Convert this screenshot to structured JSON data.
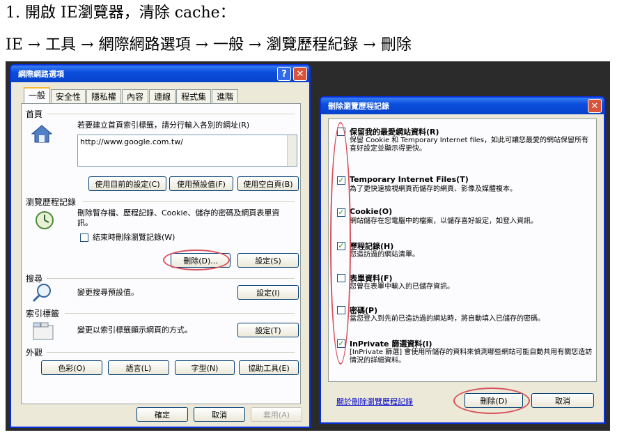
{
  "instructions": {
    "line1": "1. 開啟 IE瀏覽器，清除 cache：",
    "line2": "IE → 工具 → 網際網路選項 → 一般 → 瀏覽歷程紀錄 → 刪除"
  },
  "internet_options": {
    "title": "網際網路選項",
    "tabs": [
      "一般",
      "安全性",
      "隱私權",
      "內容",
      "連線",
      "程式集",
      "進階"
    ],
    "home": {
      "label": "首頁",
      "desc": "若要建立首頁索引標籤，請分行輸入各別的網址(R)",
      "url": "http://www.google.com.tw/",
      "buttons": [
        "使用目前的設定(C)",
        "使用預設值(F)",
        "使用空白頁(B)"
      ]
    },
    "history": {
      "label": "瀏覽歷程記錄",
      "desc": "刪除暫存檔、歷程記錄、Cookie、儲存的密碼及網頁表單資訊。",
      "checkbox": "結束時刪除瀏覽記錄(W)",
      "delete_btn": "刪除(D)...",
      "settings_btn": "設定(S)"
    },
    "search": {
      "label": "搜尋",
      "desc": "變更搜尋預設值。",
      "settings_btn": "設定(I)"
    },
    "tabs_section": {
      "label": "索引標籤",
      "desc": "變更以索引標籤顯示網頁的方式。",
      "settings_btn": "設定(T)"
    },
    "appearance": {
      "label": "外觀",
      "buttons": [
        "色彩(O)",
        "語言(L)",
        "字型(N)",
        "協助工具(E)"
      ]
    },
    "footer": {
      "ok": "確定",
      "cancel": "取消",
      "apply": "套用(A)"
    }
  },
  "delete_history": {
    "title": "刪除瀏覽歷程記錄",
    "items": [
      {
        "title": "保留我的最愛網站資料(R)",
        "desc": "保留 Cookie 和 Temporary Internet files，如此可讓您最愛的網站保留所有喜好設定並顯示得更快。",
        "checked": false
      },
      {
        "title": "Temporary Internet Files(T)",
        "desc": "為了更快速檢視網頁而儲存的網頁、影像及媒體複本。",
        "checked": true
      },
      {
        "title": "Cookie(O)",
        "desc": "網站儲存在您電腦中的檔案，以儲存喜好設定，如登入資訊。",
        "checked": true
      },
      {
        "title": "歷程記錄(H)",
        "desc": "您造訪過的網站清單。",
        "checked": true
      },
      {
        "title": "表單資料(F)",
        "desc": "您曾在表單中輸入的已儲存資訊。",
        "checked": false
      },
      {
        "title": "密碼(P)",
        "desc": "當您登入到先前已造訪過的網站時，將自動填入已儲存的密碼。",
        "checked": false
      },
      {
        "title": "InPrivate 篩選資料(I)",
        "desc": "[InPrivate 篩選] 會使用所儲存的資料來偵測哪些網站可能自動共用有關您造訪情況的詳細資料。",
        "checked": true
      }
    ],
    "link": "關於刪除瀏覽歷程記錄",
    "delete_btn": "刪除(D)",
    "cancel_btn": "取消"
  }
}
